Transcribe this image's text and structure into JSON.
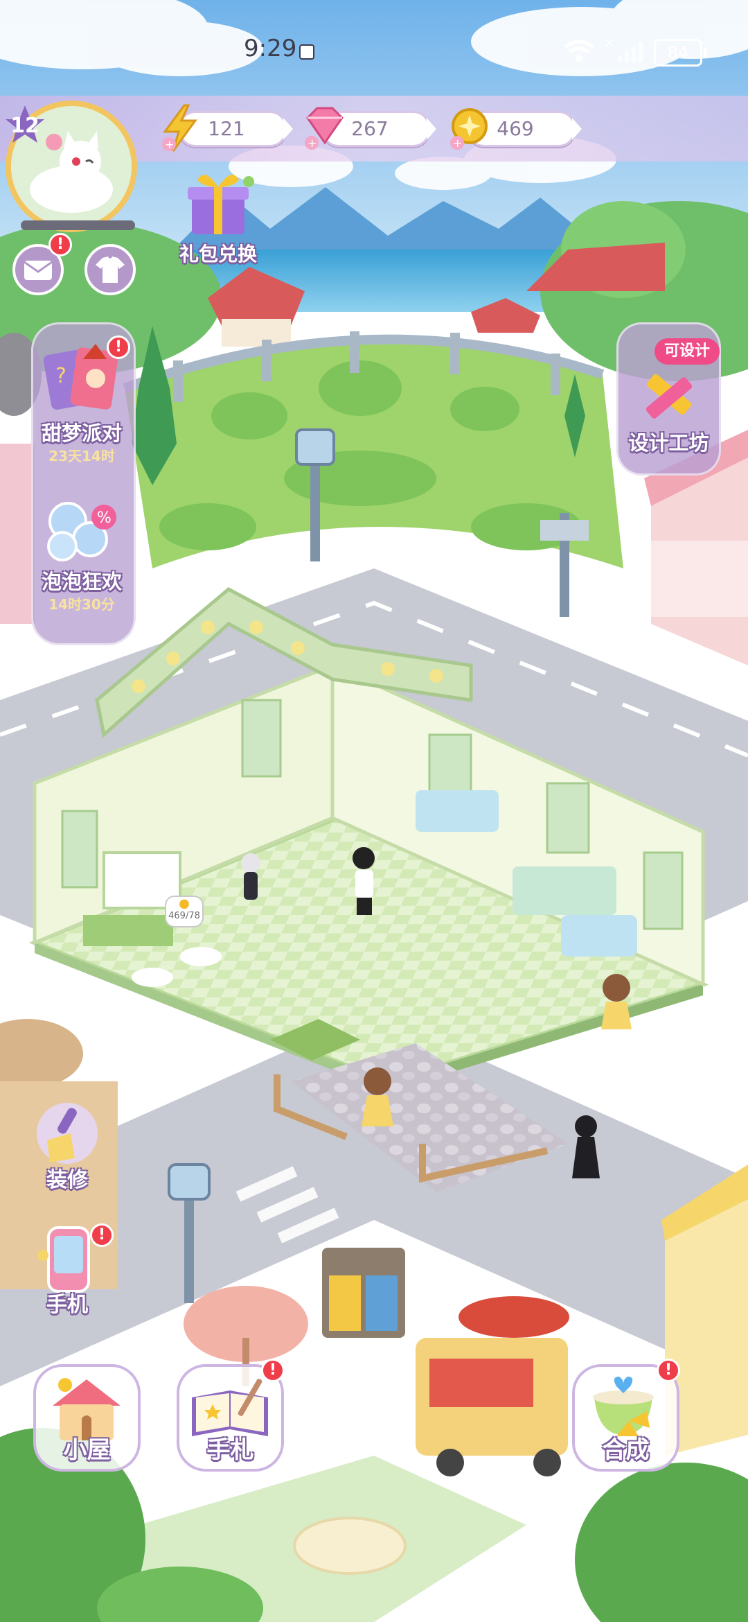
{
  "status_bar": {
    "time": "9:29",
    "battery": "84"
  },
  "resources": {
    "energy": "121",
    "diamonds": "267",
    "coins": "469"
  },
  "player": {
    "level": "12"
  },
  "gift": {
    "label": "礼包兑换"
  },
  "events": [
    {
      "label": "甜梦派对",
      "timer": "23天14时"
    },
    {
      "label": "泡泡狂欢",
      "timer": "14时30分"
    }
  ],
  "workshop": {
    "tag": "可设计",
    "label": "设计工坊"
  },
  "scene": {
    "income_bubble": "469/78"
  },
  "side_buttons": {
    "decorate": "装修",
    "phone": "手机"
  },
  "bottom_buttons": {
    "house": "小屋",
    "handbook": "手札",
    "merge": "合成"
  },
  "colors": {
    "panel": "#b9a0d2",
    "badge": "#ef3d4a",
    "accent_pink": "#ee4b87",
    "grass": "#9fd36c"
  }
}
